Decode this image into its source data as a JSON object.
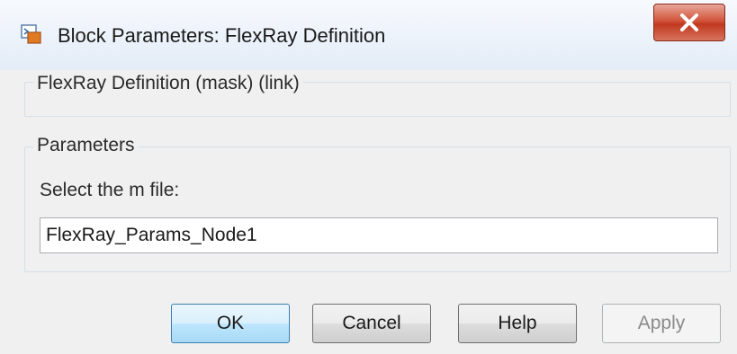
{
  "window": {
    "title": "Block Parameters: FlexRay Definition",
    "close_icon": "close-icon",
    "app_icon": "simulink-block-icon"
  },
  "mask": {
    "label": "FlexRay Definition (mask) (link)"
  },
  "parameters": {
    "group_label": "Parameters",
    "field_label": "Select the m file:",
    "field_value": "FlexRay_Params_Node1"
  },
  "buttons": {
    "ok": "OK",
    "cancel": "Cancel",
    "help": "Help",
    "apply": "Apply"
  },
  "colors": {
    "close_button": "#c0391f",
    "ok_button_border": "#3c7fb1",
    "dialog_background": "#f0f0f0"
  }
}
